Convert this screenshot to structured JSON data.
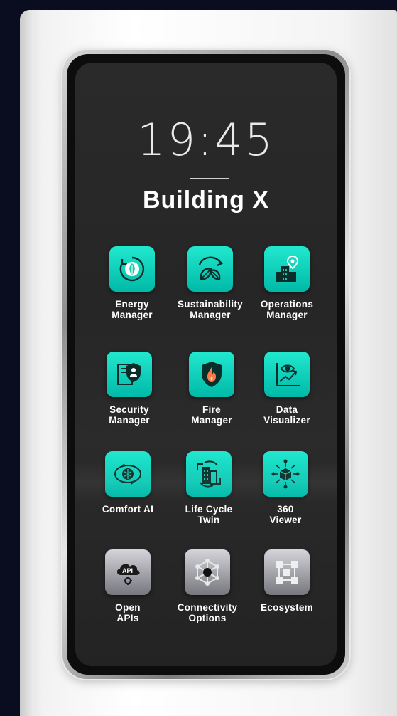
{
  "device": {
    "clock": "19:45",
    "title": "Building X"
  },
  "apps": [
    {
      "line1": "Energy",
      "line2": "Manager",
      "icon": "energy-leaf-cycle-icon",
      "style": "teal"
    },
    {
      "line1": "Sustainability",
      "line2": "Manager",
      "icon": "leaves-cycle-icon",
      "style": "teal"
    },
    {
      "line1": "Operations",
      "line2": "Manager",
      "icon": "building-pin-icon",
      "style": "teal"
    },
    {
      "line1": "Security",
      "line2": "Manager",
      "icon": "shield-user-icon",
      "style": "teal"
    },
    {
      "line1": "Fire",
      "line2": "Manager",
      "icon": "fire-shield-icon",
      "style": "teal"
    },
    {
      "line1": "Data",
      "line2": "Visualizer",
      "icon": "eye-chart-icon",
      "style": "teal"
    },
    {
      "line1": "Comfort AI",
      "line2": "",
      "icon": "brain-icon",
      "style": "teal"
    },
    {
      "line1": "Life Cycle",
      "line2": "Twin",
      "icon": "building-cycle-icon",
      "style": "teal"
    },
    {
      "line1": "360",
      "line2": "Viewer",
      "icon": "cube-360-icon",
      "style": "teal"
    },
    {
      "line1": "Open",
      "line2": "APIs",
      "icon": "api-cloud-icon",
      "style": "gray"
    },
    {
      "line1": "Connectivity",
      "line2": "Options",
      "icon": "network-hub-icon",
      "style": "gray"
    },
    {
      "line1": "Ecosystem",
      "line2": "",
      "icon": "ecosystem-grid-icon",
      "style": "gray"
    }
  ],
  "colors": {
    "page_background": "#0a0c1f",
    "screen": "#282828",
    "teal_accent": "#13d3bd",
    "gray_tile": "#a3a3aa"
  }
}
